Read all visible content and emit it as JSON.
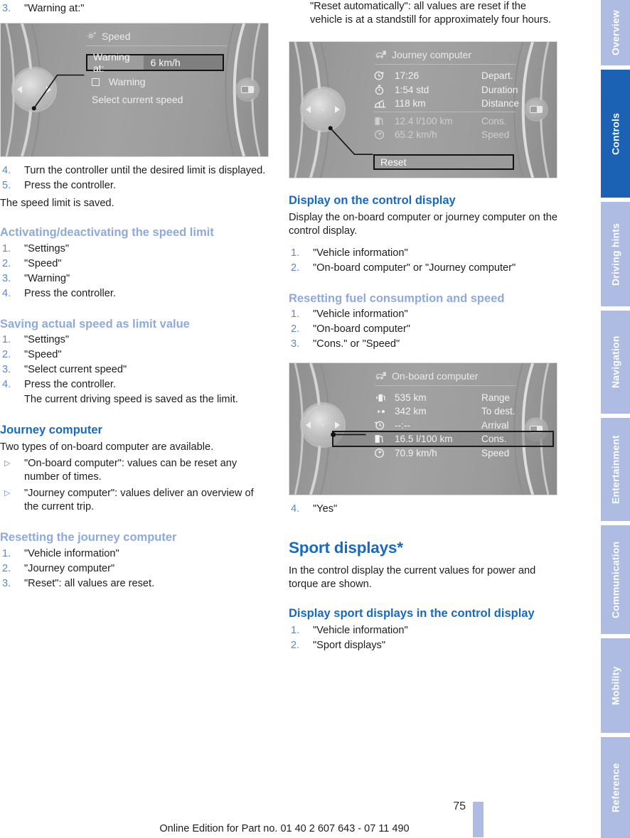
{
  "page": {
    "number": "75",
    "edition": "Online Edition for Part no. 01 40 2 607 643 - 07 11 490"
  },
  "rail": {
    "tabs": [
      {
        "label": "Overview",
        "active": false
      },
      {
        "label": "Controls",
        "active": true
      },
      {
        "label": "Driving hints",
        "active": false
      },
      {
        "label": "Navigation",
        "active": false
      },
      {
        "label": "Entertainment",
        "active": false
      },
      {
        "label": "Communication",
        "active": false
      },
      {
        "label": "Mobility",
        "active": false
      },
      {
        "label": "Reference",
        "active": false
      }
    ]
  },
  "left": {
    "step3": {
      "num": "3.",
      "text": "\"Warning at:\""
    },
    "fig_speed": {
      "title": "Speed",
      "title_icon": "gear-icon",
      "field_label": "Warning at:",
      "field_value": "6 km/h",
      "checkbox_label": "Warning",
      "option_label": "Select current speed"
    },
    "steps_after_fig": [
      {
        "num": "4.",
        "text": "Turn the controller until the desired limit is displayed."
      },
      {
        "num": "5.",
        "text": "Press the controller."
      }
    ],
    "saved_note": "The speed limit is saved.",
    "h3_activating": "Activating/deactivating the speed limit",
    "steps_activating": [
      {
        "num": "1.",
        "text": "\"Settings\""
      },
      {
        "num": "2.",
        "text": "\"Speed\""
      },
      {
        "num": "3.",
        "text": "\"Warning\""
      },
      {
        "num": "4.",
        "text": "Press the controller."
      }
    ],
    "h3_saving": "Saving actual speed as limit value",
    "steps_saving": [
      {
        "num": "1.",
        "text": "\"Settings\""
      },
      {
        "num": "2.",
        "text": "\"Speed\""
      },
      {
        "num": "3.",
        "text": "\"Select current speed\""
      },
      {
        "num": "4.",
        "text": "Press the controller."
      }
    ],
    "saving_sub": "The current driving speed is saved as the limit.",
    "h2_journey": "Journey computer",
    "journey_intro": "Two types of on-board computer are available.",
    "journey_bullets": [
      {
        "bullet": "▷",
        "text": "\"On-board computer\": values can be reset any number of times."
      },
      {
        "bullet": "▷",
        "text": "\"Journey computer\": values deliver an overview of the current trip."
      }
    ],
    "h3_resetting": "Resetting the journey computer",
    "steps_resetting": [
      {
        "num": "1.",
        "text": "\"Vehicle information\""
      },
      {
        "num": "2.",
        "text": "\"Journey computer\""
      },
      {
        "num": "3.",
        "text": "\"Reset\": all values are reset."
      }
    ]
  },
  "right": {
    "top_bullet": "\"Reset automatically\": all values are reset if the vehicle is at a standstill for approximately four hours.",
    "fig_journey": {
      "title": "Journey computer",
      "title_icon": "car-info-icon",
      "rows": [
        {
          "icon": "departure-clock-icon",
          "value": "17:26",
          "label": "Depart.",
          "dim": false
        },
        {
          "icon": "stopwatch-icon",
          "value": "1:54 std",
          "label": "Duration",
          "dim": false
        },
        {
          "icon": "distance-bridge-icon",
          "value": "118 km",
          "label": "Distance",
          "dim": false
        },
        {
          "icon": "fuel-pump-icon",
          "value": "12.4 l/100 km",
          "label": "Cons.",
          "dim": true
        },
        {
          "icon": "speedometer-icon",
          "value": "65.2 km/h",
          "label": "Speed",
          "dim": true
        }
      ],
      "button_label": "Reset"
    },
    "h2_display_control": "Display on the control display",
    "display_control_body": "Display the on-board computer or journey computer on the control display.",
    "steps_display_control": [
      {
        "num": "1.",
        "text": "\"Vehicle information\""
      },
      {
        "num": "2.",
        "text": "\"On-board computer\" or \"Journey computer\""
      }
    ],
    "h3_resetting_fuel": "Resetting fuel consumption and speed",
    "steps_resetting_fuel": [
      {
        "num": "1.",
        "text": "\"Vehicle information\""
      },
      {
        "num": "2.",
        "text": "\"On-board computer\""
      },
      {
        "num": "3.",
        "text": "\"Cons.\" or \"Speed\""
      }
    ],
    "fig_obc": {
      "title": "On-board computer",
      "title_icon": "car-info-icon",
      "rows": [
        {
          "icon": "range-fuel-icon",
          "value": "535 km",
          "label": "Range",
          "dim": false
        },
        {
          "icon": "to-destination-icon",
          "value": "342 km",
          "label": "To dest.",
          "dim": false
        },
        {
          "icon": "arrival-clock-icon",
          "value": "--:--",
          "label": "Arrival",
          "dim": false
        },
        {
          "icon": "fuel-pump-icon",
          "value": "16.5 l/100 km",
          "label": "Cons.",
          "dim": false
        },
        {
          "icon": "speedometer-icon",
          "value": "70.9 km/h",
          "label": "Speed",
          "dim": false
        }
      ],
      "highlighted_row_index": 3
    },
    "step4_yes": {
      "num": "4.",
      "text": "\"Yes\""
    },
    "h1_sport": "Sport displays*",
    "sport_body": "In the control display the current values for power and torque are shown.",
    "h2_sport_display": "Display sport displays in the control display",
    "steps_sport": [
      {
        "num": "1.",
        "text": "\"Vehicle information\""
      },
      {
        "num": "2.",
        "text": "\"Sport displays\""
      }
    ]
  },
  "colors": {
    "heading_dark_blue": "#1769c4",
    "heading_light_blue": "#8fa9da",
    "step_number_blue": "#5b87cc",
    "tab_inactive": "#aebbe2",
    "tab_active": "#1b62b5"
  }
}
